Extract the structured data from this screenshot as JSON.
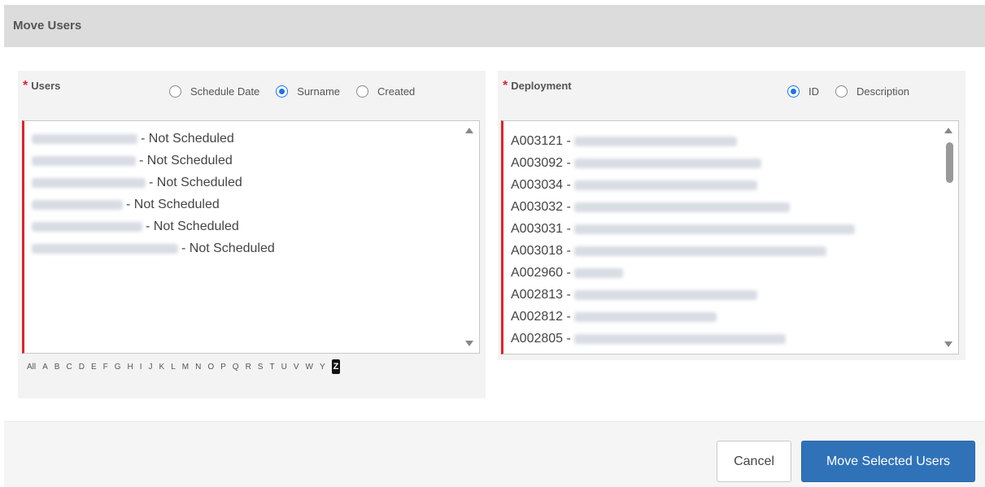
{
  "header": {
    "title": "Move Users"
  },
  "users_panel": {
    "label": "Users",
    "sort_options": [
      {
        "label": "Schedule Date",
        "selected": false
      },
      {
        "label": "Surname",
        "selected": true
      },
      {
        "label": "Created",
        "selected": false
      }
    ],
    "items": [
      {
        "suffix": "- Not Scheduled"
      },
      {
        "suffix": "- Not Scheduled"
      },
      {
        "suffix": "- Not Scheduled"
      },
      {
        "suffix": "- Not Scheduled"
      },
      {
        "suffix": "- Not Scheduled"
      },
      {
        "suffix": "- Not Scheduled"
      }
    ],
    "alphabet": [
      "All",
      "A",
      "B",
      "C",
      "D",
      "E",
      "F",
      "G",
      "H",
      "I",
      "J",
      "K",
      "L",
      "M",
      "N",
      "O",
      "P",
      "Q",
      "R",
      "S",
      "T",
      "U",
      "V",
      "W",
      "Y",
      "Z"
    ],
    "active_letter": "Z"
  },
  "deployment_panel": {
    "label": "Deployment",
    "sort_options": [
      {
        "label": "ID",
        "selected": true
      },
      {
        "label": "Description",
        "selected": false
      }
    ],
    "items": [
      {
        "id": "A003121 -"
      },
      {
        "id": "A003092 -"
      },
      {
        "id": "A003034 -"
      },
      {
        "id": "A003032 -"
      },
      {
        "id": "A003031 -"
      },
      {
        "id": "A003018 -"
      },
      {
        "id": "A002960 -"
      },
      {
        "id": "A002813 -"
      },
      {
        "id": "A002812 -"
      },
      {
        "id": "A002805 -"
      }
    ]
  },
  "footer": {
    "cancel_label": "Cancel",
    "move_label": "Move Selected Users"
  },
  "colors": {
    "required": "#d9262b",
    "primary_button": "#2f72b8",
    "radio_selected": "#1a73e8"
  }
}
